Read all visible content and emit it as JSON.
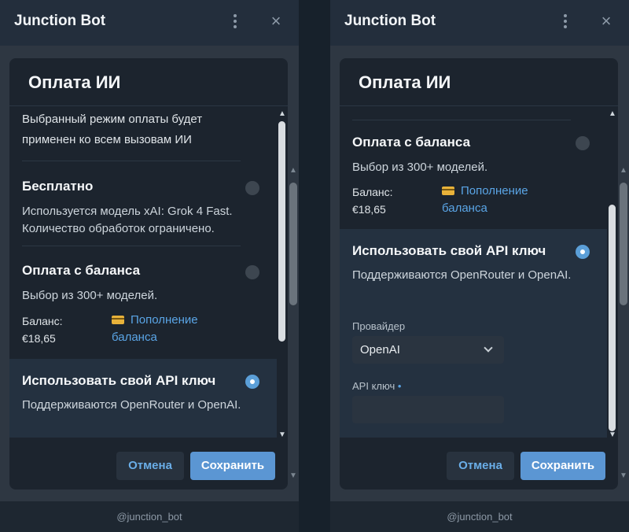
{
  "app": {
    "title": "Junction Bot",
    "username": "@junction_bot"
  },
  "modal": {
    "title": "Оплата ИИ",
    "intro": "Выбранный режим оплаты будет применен ко всем вызовам ИИ",
    "options": {
      "free": {
        "title": "Бесплатно",
        "description": "Используется модель xAI: Grok 4 Fast. Количество обработок ограничено.",
        "selected": false
      },
      "balance": {
        "title": "Оплата с баланса",
        "description": "Выбор из 300+ моделей.",
        "balance_label": "Баланс:",
        "balance_value": "€18,65",
        "topup_label": "Пополнение баланса",
        "selected": false
      },
      "own_key": {
        "title": "Использовать свой API ключ",
        "description": "Поддерживаются OpenRouter и OpenAI.",
        "selected": true,
        "provider_label": "Провайдер",
        "provider_value": "OpenAI",
        "api_key_label": "API ключ",
        "api_key_required_mark": "•",
        "api_key_value": ""
      }
    },
    "buttons": {
      "cancel": "Отмена",
      "save": "Сохранить"
    }
  },
  "icons": {
    "menu": "more-vertical-icon",
    "close": "close-icon",
    "card": "credit-card-icon",
    "chevron": "chevron-down-icon"
  },
  "colors": {
    "accent": "#5b96d3",
    "link": "#5aa5e6",
    "background": "#17212b",
    "panel": "#1c242e"
  }
}
